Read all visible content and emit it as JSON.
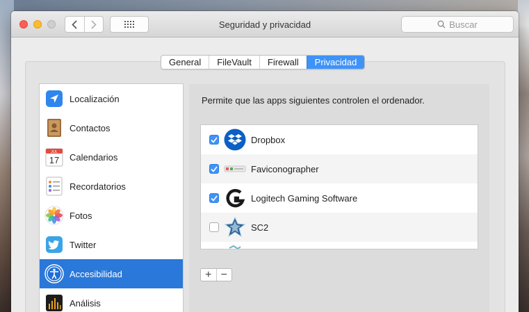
{
  "window": {
    "title": "Seguridad y privacidad",
    "search_placeholder": "Buscar"
  },
  "toolbar": {
    "back_icon": "chevron-left-icon",
    "forward_icon": "chevron-right-icon",
    "show_all_icon": "grid-icon"
  },
  "tabs": [
    {
      "label": "General",
      "selected": false
    },
    {
      "label": "FileVault",
      "selected": false
    },
    {
      "label": "Firewall",
      "selected": false
    },
    {
      "label": "Privacidad",
      "selected": true
    }
  ],
  "sidebar": {
    "items": [
      {
        "label": "Localización",
        "icon": "location-arrow-icon",
        "selected": false
      },
      {
        "label": "Contactos",
        "icon": "contacts-book-icon",
        "selected": false
      },
      {
        "label": "Calendarios",
        "icon": "calendar-icon",
        "calendar_month": "JUL",
        "calendar_day": "17",
        "selected": false
      },
      {
        "label": "Recordatorios",
        "icon": "reminders-icon",
        "selected": false
      },
      {
        "label": "Fotos",
        "icon": "photos-icon",
        "selected": false
      },
      {
        "label": "Twitter",
        "icon": "twitter-bird-icon",
        "selected": false
      },
      {
        "label": "Accesibilidad",
        "icon": "accessibility-icon",
        "selected": true
      },
      {
        "label": "Análisis",
        "icon": "diagnostics-icon",
        "selected": false
      }
    ]
  },
  "main": {
    "description": "Permite que las apps siguientes controlen el ordenador.",
    "apps": [
      {
        "name": "Dropbox",
        "checked": true,
        "icon": "dropbox-icon"
      },
      {
        "name": "Faviconographer",
        "checked": true,
        "icon": "faviconographer-icon"
      },
      {
        "name": "Logitech Gaming Software",
        "checked": true,
        "icon": "logitech-g-icon"
      },
      {
        "name": "SC2",
        "checked": false,
        "icon": "starcraft-icon"
      }
    ],
    "add_label": "+",
    "remove_label": "−"
  },
  "colors": {
    "accent": "#3e93f8",
    "selection": "#2a78d9",
    "close": "#fc5f57",
    "minimize": "#fdbc2e"
  }
}
